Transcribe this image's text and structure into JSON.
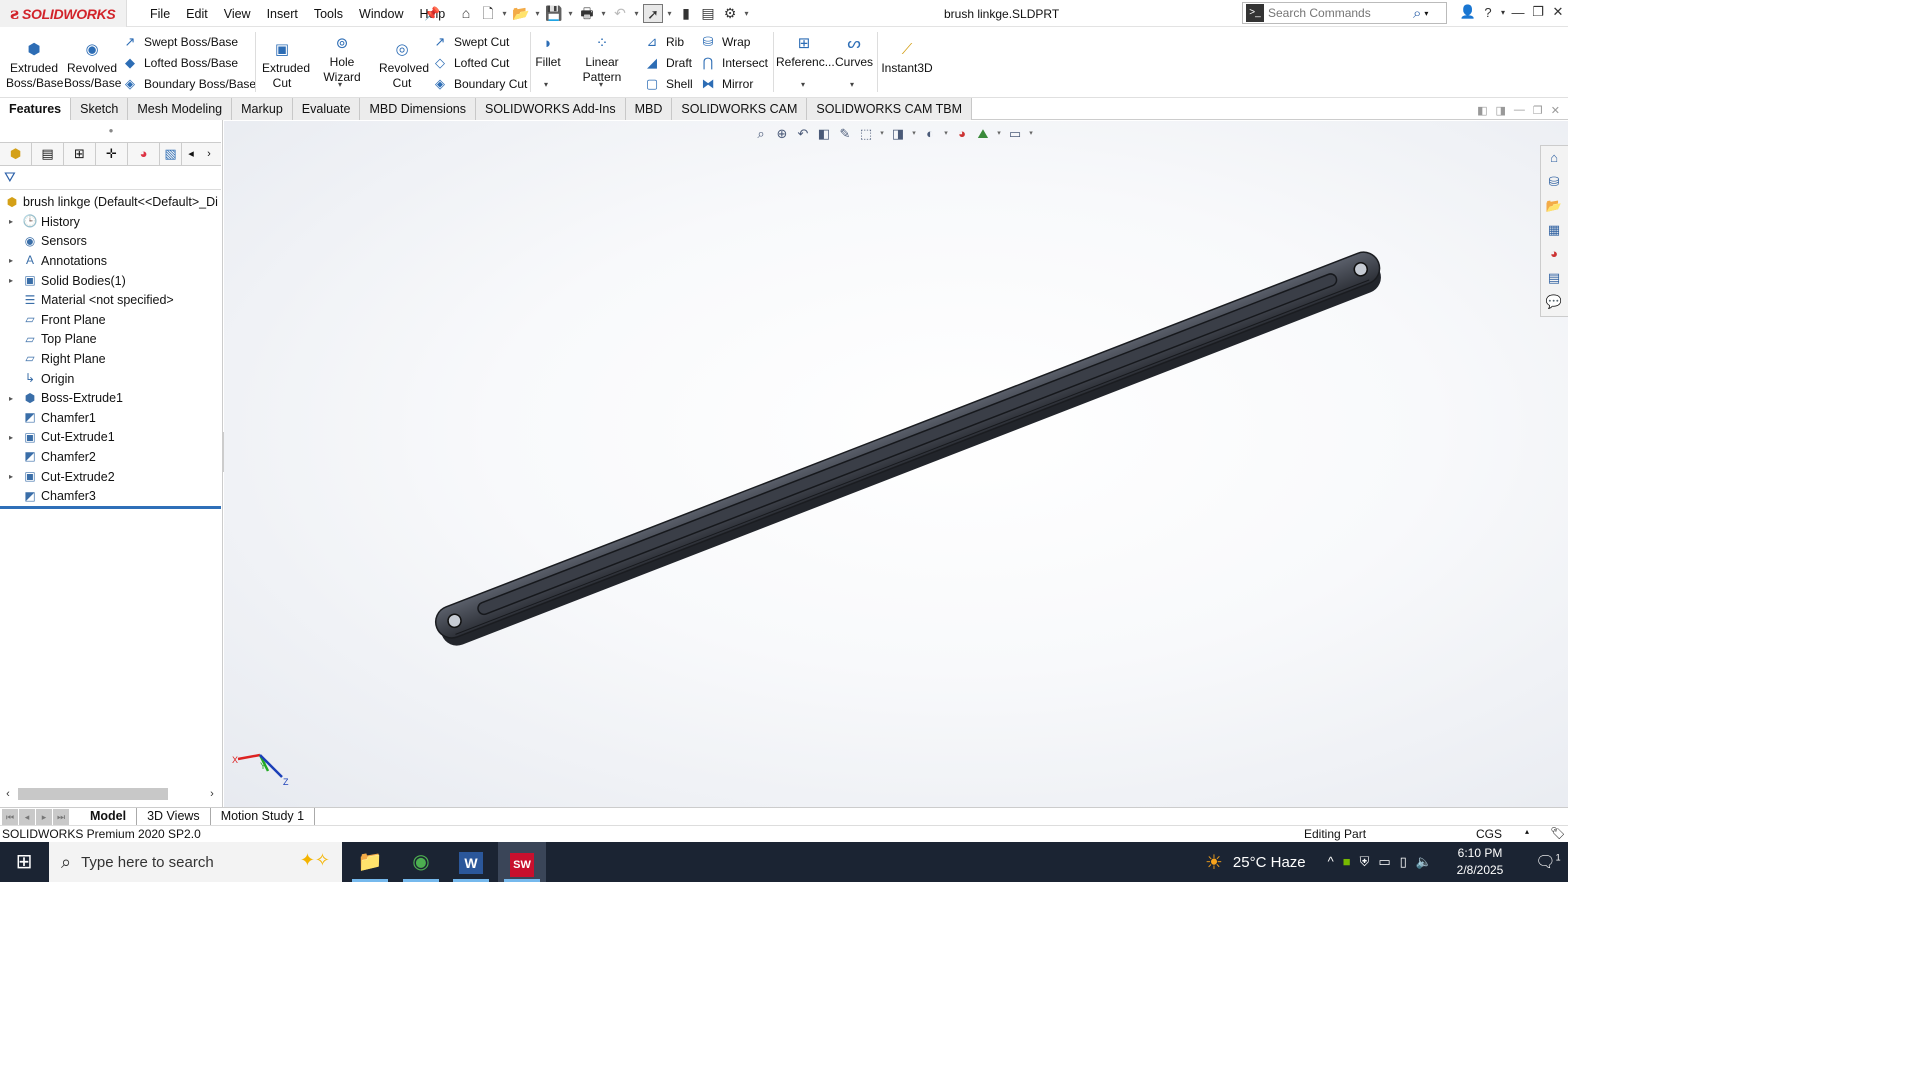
{
  "app": {
    "logo_mark": "ƨ",
    "logo_text": "SOLIDWORKS",
    "document_title": "brush linkge.SLDPRT"
  },
  "menu": [
    "File",
    "Edit",
    "View",
    "Insert",
    "Tools",
    "Window",
    "Help"
  ],
  "search": {
    "placeholder": "Search Commands"
  },
  "ribbon": {
    "extruded_boss": "Extruded Boss/Base",
    "revolved_boss": "Revolved Boss/Base",
    "swept_boss": "Swept Boss/Base",
    "lofted_boss": "Lofted Boss/Base",
    "boundary_boss": "Boundary Boss/Base",
    "extruded_cut": "Extruded Cut",
    "hole_wizard": "Hole Wizard",
    "revolved_cut": "Revolved Cut",
    "swept_cut": "Swept Cut",
    "lofted_cut": "Lofted Cut",
    "boundary_cut": "Boundary Cut",
    "fillet": "Fillet",
    "linear_pattern": "Linear Pattern",
    "rib": "Rib",
    "draft": "Draft",
    "shell": "Shell",
    "wrap": "Wrap",
    "intersect": "Intersect",
    "mirror": "Mirror",
    "reference": "Referenc...",
    "curves": "Curves",
    "instant3d": "Instant3D"
  },
  "tabs": [
    "Features",
    "Sketch",
    "Mesh Modeling",
    "Markup",
    "Evaluate",
    "MBD Dimensions",
    "SOLIDWORKS Add-Ins",
    "MBD",
    "SOLIDWORKS CAM",
    "SOLIDWORKS CAM TBM"
  ],
  "tree": {
    "root": "brush linkge  (Default<<Default>_Di",
    "items": [
      "History",
      "Sensors",
      "Annotations",
      "Solid Bodies(1)",
      "Material <not specified>",
      "Front Plane",
      "Top Plane",
      "Right Plane",
      "Origin",
      "Boss-Extrude1",
      "Chamfer1",
      "Cut-Extrude1",
      "Chamfer2",
      "Cut-Extrude2",
      "Chamfer3"
    ]
  },
  "triad": {
    "x": "X",
    "y": "Y",
    "z": "Z"
  },
  "bottom_tabs": [
    "Model",
    "3D Views",
    "Motion Study 1"
  ],
  "status": {
    "product": "SOLIDWORKS Premium 2020 SP2.0",
    "mode": "Editing Part",
    "units": "CGS"
  },
  "taskbar": {
    "search_placeholder": "Type here to search",
    "weather": "25°C  Haze",
    "time": "6:10 PM",
    "date": "2/8/2025",
    "notification_count": "1"
  }
}
